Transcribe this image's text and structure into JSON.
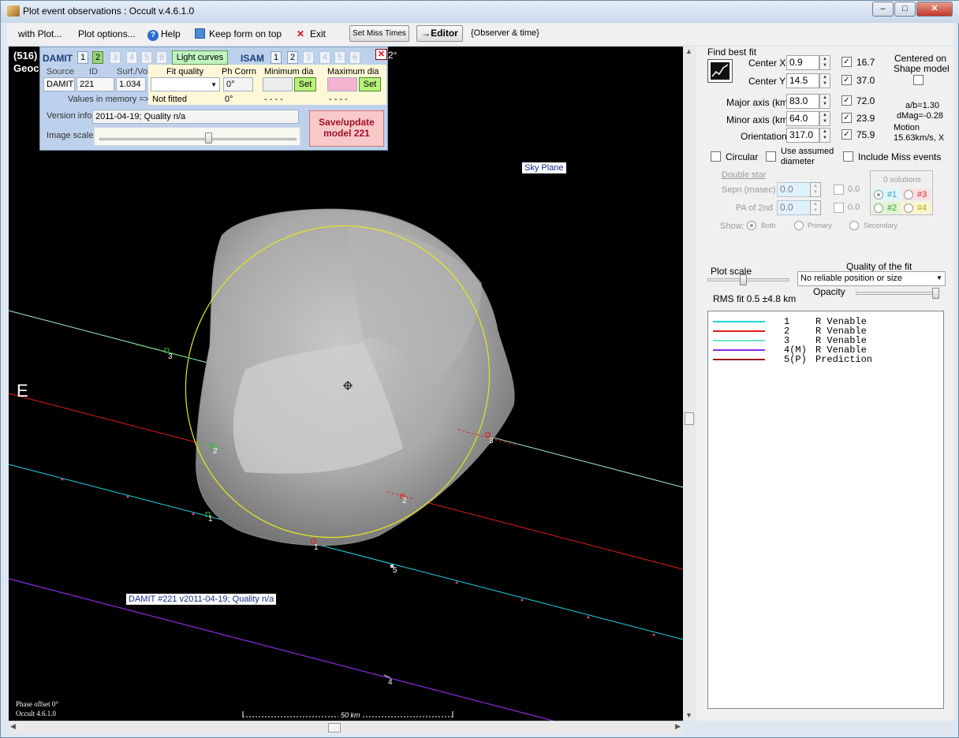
{
  "window": {
    "title": "Plot event observations : Occult v.4.6.1.0",
    "min_label": "–",
    "max_label": "□",
    "close_label": "✕"
  },
  "menu": {
    "with_plot": "with Plot...",
    "plot_options": "Plot options...",
    "help": "Help",
    "keep_form": "Keep form on top",
    "exit": "Exit",
    "set_miss_times": "Set Miss Times",
    "editor": "→Editor",
    "observer_time": "{Observer & time}"
  },
  "plot": {
    "header_left_1": "(516)",
    "header_left_2": "Geoc",
    "header_right": "2°",
    "east_label": "E",
    "sky_plane": "Sky Plane",
    "model_tag": "DAMIT #221 v2011-04-19; Quality n/a",
    "phase_offset": "Phase offset 0°",
    "occult_ver": "Occult 4.6.1.0",
    "scale_label": "50 km",
    "chord_labels": {
      "c1_limb": "1",
      "c1_edge": "1",
      "c2_left": "2",
      "c2_right": "2",
      "c3_left": "3",
      "c3_right": "3",
      "c4": "4",
      "c5": "5"
    }
  },
  "model_panel": {
    "damit": "DAMIT",
    "isam": "ISAM",
    "damit_buttons": [
      "1",
      "2",
      "3",
      "4",
      "5",
      "6"
    ],
    "damit_selected": "2",
    "isam_buttons": [
      "1",
      "2",
      "3",
      "4",
      "5",
      "6"
    ],
    "light_curves": "Light curves",
    "source_lbl": "Source",
    "id_lbl": "ID",
    "surf_lbl": "Surf./Vol",
    "source_val": "DAMIT",
    "id_val": "221",
    "surf_val": "1.034",
    "values_mem": "Values in memory =>",
    "fit_quality": "Fit quality",
    "ph_corr": "Ph Corrn",
    "min_dia": "Minimum dia",
    "max_dia": "Maximum dia",
    "ph_corr_val": "0°",
    "ph_corr_val2": "0°",
    "set_label": "Set",
    "not_fitted": "Not fitted",
    "dashes_1": "- - - -",
    "dashes_2": "- - - -",
    "version_lbl": "Version info",
    "version_val": "2011-04-19; Quality n/a",
    "image_scale": "Image scale",
    "image_scale_level": 0.55,
    "save_btn_line1": "Save/update",
    "save_btn_line2": "model 221"
  },
  "fit": {
    "find_best_fit": "Find best fit",
    "center_x_lbl": "Center X",
    "center_x": "0.9",
    "center_x_sd": "16.7",
    "center_y_lbl": "Center Y",
    "center_y": "14.5",
    "center_y_sd": "37.0",
    "major_lbl": "Major axis (km)",
    "major": "83.0",
    "major_sd": "72.0",
    "minor_lbl": "Minor axis (km)",
    "minor": "64.0",
    "minor_sd": "23.9",
    "orient_lbl": "Orientation",
    "orient": "317.0",
    "orient_sd": "75.9",
    "centered_1": "Centered on",
    "centered_2": "Shape model",
    "ab": "a/b=1.30",
    "dmag": "dMag=-0.28",
    "motion_1": "Motion",
    "motion_2": "15.63km/s, X",
    "circular": "Circular",
    "use_assumed_1": "Use assumed",
    "use_assumed_2": "diameter",
    "include_miss": "Include Miss events",
    "double_star": "Double star",
    "sepn_lbl": "Sepn (masec)",
    "sepn_val": "0.0",
    "sepn_sd": "0.0",
    "pa_lbl": "PA of 2nd",
    "pa_val": "0.0",
    "pa_sd": "0.0",
    "show_lbl": "Show:",
    "show_both": "Both",
    "show_primary": "Primary",
    "show_secondary": "Secondary",
    "solutions": "0 solutions",
    "sol1": "#1",
    "sol2": "#2",
    "sol3": "#3",
    "sol4": "#4",
    "plot_scale": "Plot scale",
    "quality_lbl": "Quality of the fit",
    "quality_val": "No reliable position or size",
    "opacity": "Opacity",
    "rms": "RMS fit 0.5 ±4.8 km"
  },
  "legend": [
    {
      "num": "1",
      "obs": "R Venable",
      "color": "#1fd6e6"
    },
    {
      "num": "2",
      "obs": "R Venable",
      "color": "#e51a1a"
    },
    {
      "num": "3",
      "obs": "R Venable",
      "color": "#6fe8c8"
    },
    {
      "num": "4(M)",
      "obs": "R Venable",
      "color": "#8a2be2"
    },
    {
      "num": "5(P)",
      "obs": "Prediction",
      "color": "#a01818"
    }
  ],
  "colors": {
    "chord1": "#1fd6e6",
    "chord2": "#e51a1a",
    "chord3": "#a8f0d2",
    "chord4": "#8a2be2",
    "ellipse": "#e8e81a"
  }
}
